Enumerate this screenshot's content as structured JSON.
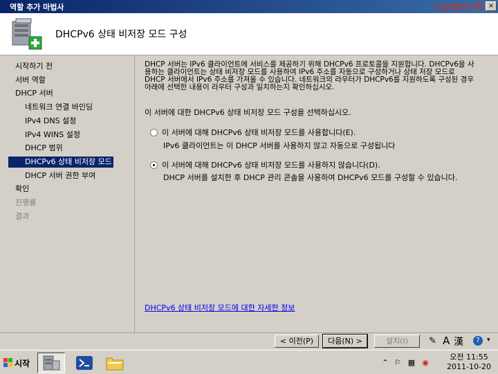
{
  "window": {
    "title": "역할 추가 마법사",
    "host_label": "London-DC1",
    "close_label": "×"
  },
  "header": {
    "title": "DHCPv6 상태 비저장 모드 구성"
  },
  "nav": {
    "items": [
      {
        "label": "시작하기 전",
        "state": "normal"
      },
      {
        "label": "서버 역할",
        "state": "normal"
      },
      {
        "label": "DHCP 서버",
        "state": "normal"
      },
      {
        "label": "네트워크 연결 바인딩",
        "state": "normal"
      },
      {
        "label": "IPv4 DNS 설정",
        "state": "normal"
      },
      {
        "label": "IPv4 WINS 설정",
        "state": "normal"
      },
      {
        "label": "DHCP 범위",
        "state": "normal"
      },
      {
        "label": "DHCPv6 상태 비저장 모드",
        "state": "selected"
      },
      {
        "label": "DHCP 서버 권한 부여",
        "state": "normal"
      },
      {
        "label": "확인",
        "state": "normal"
      },
      {
        "label": "진행률",
        "state": "disabled"
      },
      {
        "label": "결과",
        "state": "disabled"
      }
    ]
  },
  "content": {
    "description": "DHCP 서버는 IPv6 클라이언트에 서비스를 제공하기 위해 DHCPv6 프로토콜을 지원합니다. DHCPv6을 사용하는 클라이언트는 상태 비저장 모드를 사용하여 IPv6 주소를 자동으로 구성하거나 상태 저장 모드로 DHCP 서버에서 IPv6 주소를 가져올 수 있습니다. 네트워크의 라우터가 DHCPv6를 지원하도록 구성된 경우 아래에 선택한 내용이 라우터 구성과 일치하는지 확인하십시오.",
    "prompt": "이 서버에 대한 DHCPv6 상태 비저장 모드 구성을 선택하십시오.",
    "option_enable": {
      "label": "이 서버에 대해 DHCPv6 상태 비저장 모드를 사용합니다(E).",
      "sub": "IPv6 클라이언트는 이 DHCP 서버를 사용하지 않고 자동으로 구성됩니다",
      "checked": false
    },
    "option_disable": {
      "label": "이 서버에 대해 DHCPv6 상태 비저장 모드를 사용하지 않습니다(D).",
      "sub": "DHCP 서버를 설치한 후 DHCP 관리 콘솔을 사용하여 DHCPv6 모드를 구성할 수 있습니다.",
      "checked": true
    },
    "more_info_link": "DHCPv6 상태 비저장 모드에 대한 자세한 정보"
  },
  "footer": {
    "prev_label": "< 이전(P)",
    "next_label": "다음(N) >",
    "install_label": "설치(I)"
  },
  "taskbar": {
    "start_label": "시작",
    "clock_time": "오전 11:55",
    "clock_date": "2011-10-20",
    "tray_lang_a": "A",
    "tray_lang_han": "漢"
  },
  "colors": {
    "title_bar": "#0a246a",
    "selection": "#0a246a",
    "host_label": "#e0241c",
    "link": "#0000ee"
  }
}
